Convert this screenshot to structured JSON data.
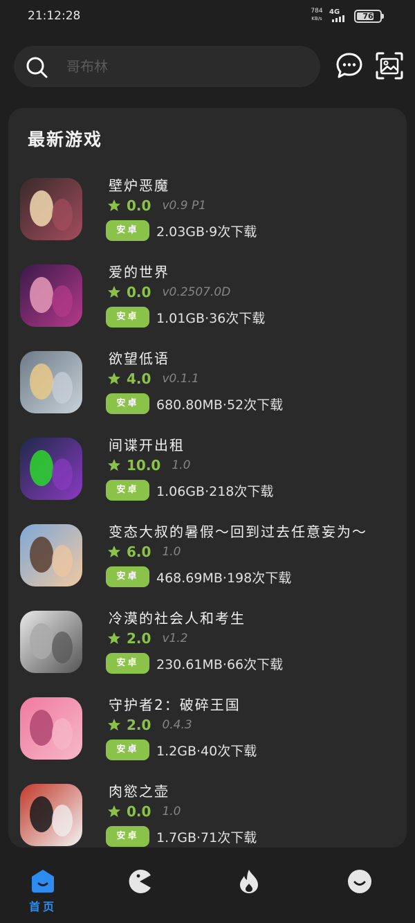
{
  "status_bar": {
    "time": "21:12:28",
    "net_speed": "784",
    "net_unit": "KB/s",
    "network": "4G",
    "battery": "76"
  },
  "search": {
    "placeholder": "哥布林"
  },
  "main": {
    "section_title": "最新游戏",
    "games": [
      {
        "title": "壁炉恶魔",
        "rating": "0.0",
        "version": "v0.9 P1",
        "platform": "安卓",
        "meta": "2.03GB·9次下载",
        "cover_colors": [
          "#3a2a2a",
          "#a34d5d",
          "#f1d9b0"
        ]
      },
      {
        "title": "爱的世界",
        "rating": "0.0",
        "version": "v0.2507.0D",
        "platform": "安卓",
        "meta": "1.01GB·36次下载",
        "cover_colors": [
          "#3a1a4a",
          "#b53a8a",
          "#e59ab8"
        ]
      },
      {
        "title": "欲望低语",
        "rating": "4.0",
        "version": "v0.1.1",
        "platform": "安卓",
        "meta": "680.80MB·52次下载",
        "cover_colors": [
          "#6d7b86",
          "#c9d2da",
          "#e8c98a"
        ]
      },
      {
        "title": "间谍开出租",
        "rating": "10.0",
        "version": "1.0",
        "platform": "安卓",
        "meta": "1.06GB·218次下载",
        "cover_colors": [
          "#1e2a4a",
          "#8a3ac0",
          "#2bd62b"
        ]
      },
      {
        "title": "变态大叔的暑假～回到过去任意妄为～",
        "rating": "6.0",
        "version": "1.0",
        "platform": "安卓",
        "meta": "468.69MB·198次下载",
        "cover_colors": [
          "#7ea8d8",
          "#f0c8a0",
          "#5a4030"
        ]
      },
      {
        "title": "冷漠的社会人和考生",
        "rating": "2.0",
        "version": "v1.2",
        "platform": "安卓",
        "meta": "230.61MB·66次下载",
        "cover_colors": [
          "#e8e8e8",
          "#555555",
          "#aaaaaa"
        ]
      },
      {
        "title": "守护者2：破碎王国",
        "rating": "2.0",
        "version": "0.4.3",
        "platform": "安卓",
        "meta": "1.2GB·40次下载",
        "cover_colors": [
          "#f07aa0",
          "#f6b8c8",
          "#b04870"
        ]
      },
      {
        "title": "肉慾之壶",
        "rating": "0.0",
        "version": "1.0",
        "platform": "安卓",
        "meta": "1.7GB·71次下载",
        "cover_colors": [
          "#c23a2a",
          "#f2f2f2",
          "#1a1a1a"
        ]
      }
    ]
  },
  "bottom_nav": {
    "home_label": "首页",
    "active_color": "#2d8cf0",
    "inactive_color": "#e6e6e6"
  },
  "colors": {
    "accent_green": "#8bc34a",
    "background": "#1f1f1f",
    "card": "#2a2a2a"
  },
  "icons": {
    "search": "search-icon",
    "message": "chat-bubble-icon",
    "image_search": "image-search-icon",
    "star": "star-icon",
    "home": "home-icon",
    "pacman": "pacman-icon",
    "fire": "fire-icon",
    "profile": "smile-icon"
  }
}
